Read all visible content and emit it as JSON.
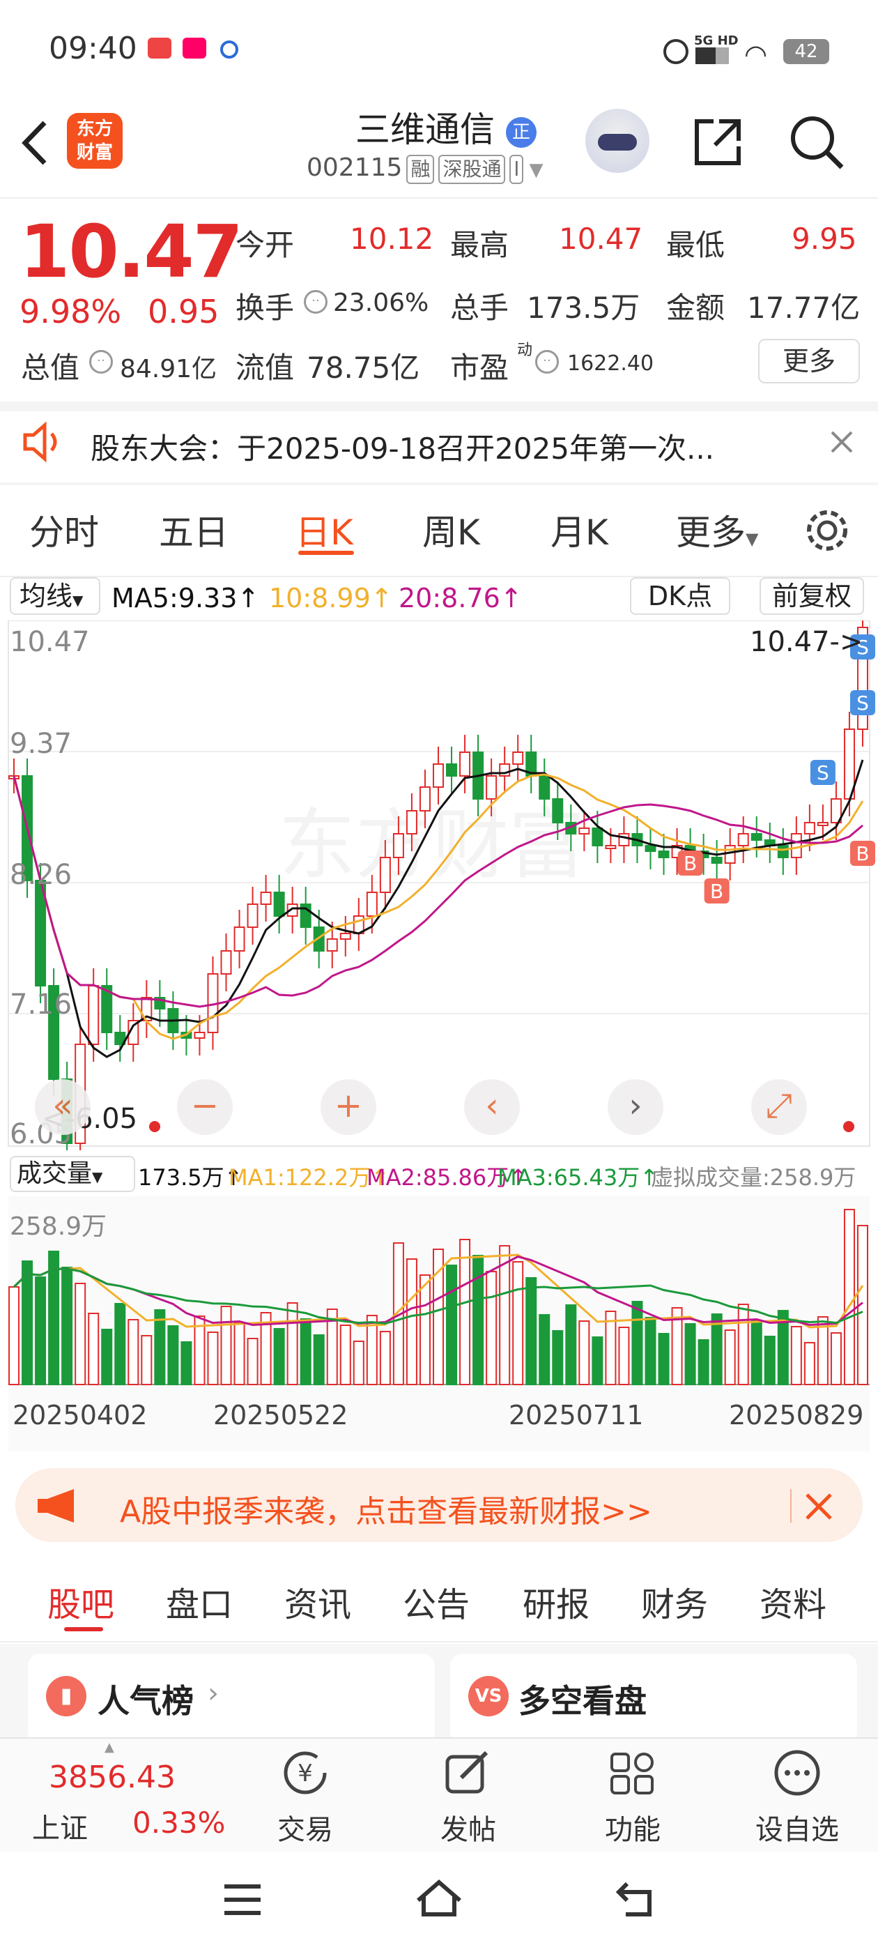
{
  "status_bar": {
    "time": "09:40",
    "network": "5G HD",
    "battery": "42"
  },
  "header": {
    "logo_text": "东方\n财富",
    "stock_name": "三维通信",
    "stock_badge": "正",
    "code": "002115",
    "tags": [
      "融",
      "深股通",
      "l"
    ]
  },
  "quote": {
    "price": "10.47",
    "change_pct": "9.98%",
    "change": "0.95",
    "open_label": "今开",
    "open": "10.12",
    "high_label": "最高",
    "high": "10.47",
    "low_label": "最低",
    "low": "9.95",
    "turnover_label": "换手",
    "turnover": "23.06%",
    "volume_label": "总手",
    "volume": "173.5万",
    "amount_label": "金额",
    "amount": "17.77亿",
    "mcap_label": "总值",
    "mcap": "84.91亿",
    "float_label": "流值",
    "float": "78.75亿",
    "pe_label": "市盈",
    "pe_sup": "动",
    "pe": "1622.40",
    "more": "更多"
  },
  "notice": {
    "text": "股东大会：于2025-09-18召开2025年第一次..."
  },
  "chart_tabs": [
    "分时",
    "五日",
    "日K",
    "周K",
    "月K",
    "更多"
  ],
  "chart_tab_active": 2,
  "kline": {
    "indicator": "均线",
    "ma5": "MA5:9.33",
    "ma10": "10:8.99",
    "ma20": "20:8.76",
    "dk": "DK点",
    "adjust": "前复权",
    "y_labels": [
      "10.47",
      "9.37",
      "8.26",
      "7.16",
      "6.05"
    ],
    "high_marker": "10.47->",
    "low_marker": "<-6.05",
    "signals": [
      "S",
      "S",
      "S",
      "B",
      "B",
      "B"
    ]
  },
  "volume": {
    "indicator": "成交量",
    "vol": "173.5万",
    "ma1": "MA1:122.2万",
    "ma2": "MA2:85.86万",
    "ma3": "MA3:65.43万",
    "virtual": "虚拟成交量:258.9万",
    "max_label": "258.9万",
    "dates": [
      "20250402",
      "20250522",
      "20250711",
      "20250829"
    ]
  },
  "banner": {
    "text": "A股中报季来袭，点击查看最新财报>>"
  },
  "section_tabs": [
    "股吧",
    "盘口",
    "资讯",
    "公告",
    "研报",
    "财务",
    "资料"
  ],
  "section_active": 0,
  "cards": [
    {
      "label": "人气榜"
    },
    {
      "label": "多空看盘"
    }
  ],
  "bottom": {
    "index_value": "3856.43",
    "index_name": "上证",
    "index_change": "0.33%",
    "items": [
      "交易",
      "发帖",
      "功能",
      "设自选"
    ]
  },
  "colors": {
    "up": "#e22b2b",
    "down": "#1a9a3b",
    "ma5": "#111111",
    "ma10": "#f2b02b",
    "ma20": "#c0168a",
    "accent": "#f4511e"
  }
}
